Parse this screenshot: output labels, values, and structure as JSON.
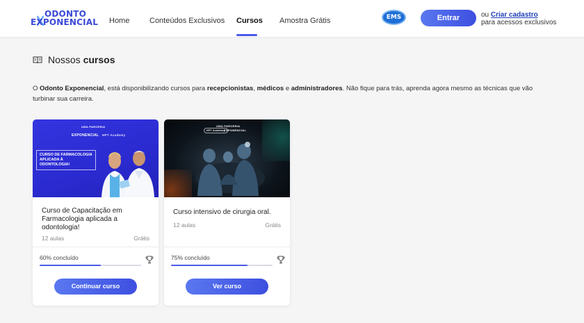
{
  "header": {
    "logo": {
      "line1": "ODONTO",
      "line2": "EXPONENCIAL"
    },
    "nav": [
      {
        "label": "Home"
      },
      {
        "label": "Conteúdos Exclusivos"
      },
      {
        "label": "Cursos",
        "active": true
      },
      {
        "label": "Amostra Grátis"
      }
    ],
    "partner_badge": "EMS",
    "login_button": "Entrar",
    "signup_prefix": "ou",
    "signup_link": "Criar cadastro",
    "signup_suffix": "para acessos exclusivos"
  },
  "section": {
    "title_prefix": "Nossos",
    "title_bold": "cursos",
    "intro": {
      "t1": "O ",
      "b1": "Odonto Exponencial",
      "t2": ", está disponibilizando cursos para ",
      "b2": "recepcionistas",
      "t3": ", ",
      "b3": "médicos",
      "t4": " e ",
      "b4": "administradores",
      "t5": ".  Não fique para trás, aprenda agora mesmo as técnicas que vão turbinar sua carreira."
    }
  },
  "courses": [
    {
      "thumb": {
        "partnership": "UMA PARCERIA",
        "brand": "EXPONENCIAL",
        "academy": "HPT Academy",
        "headline": "CURSO DE FARMACOLOGIA APLICADA À ODONTOLOGIA!"
      },
      "title": "Curso de Capacitação em Farmacologia aplicada a odontologia!",
      "lessons": "12 aulas",
      "price": "Grátis",
      "progress_label": "60% concluído",
      "progress": 0.6,
      "button": "Continuar curso"
    },
    {
      "thumb": {
        "partnership": "UMA PARCERIA",
        "brand": "EXPONENCIAL",
        "academy": "HPT Academy"
      },
      "title": "Curso intensivo de cirurgia oral.",
      "lessons": "12 aulas",
      "price": "Grátis",
      "progress_label": "75% concluído",
      "progress": 0.75,
      "button": "Ver curso"
    }
  ],
  "colors": {
    "accent": "#4a5ae8",
    "brand": "#3a49d6",
    "link": "#1d3fb8"
  }
}
